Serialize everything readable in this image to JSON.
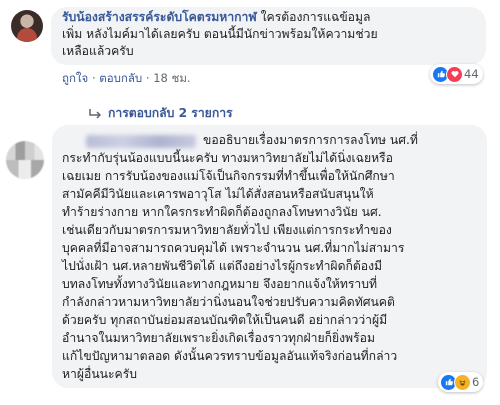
{
  "comment1": {
    "author": "รับน้องสร้างสรรค์ระดับโคตรมหากาฬ",
    "text_line1_rest": " ใครต้องการแฉข้อมูล",
    "text_line2": "เพิ่ม หลังไมค์มาได้เลยครับ ตอนนี้มีนักข่าวพร้อมให้ความช่วย",
    "text_line3": "เหลือแล้วครับ",
    "actions": {
      "like": "ถูกใจ",
      "reply": "ตอบกลับ",
      "dot": "·",
      "time": "18 ชม."
    },
    "reaction_count": "44",
    "replies_label": "การตอบกลับ 2 รายการ"
  },
  "comment2": {
    "lines": [
      "ขออธิบายเรื่องมาตรการการลงโทษ นศ.ที่",
      "กระทำกับรุ่นน้องแบบนี้นะครับ ทางมหาวิทยาลัยไม่ได้นิ่งเฉยหรือ",
      "เฉยเมย การรับน้องของแม่โจ้เป็นกิจกรรมที่ทำขึ้นเพื่อให้นักศึกษา",
      "สามัคคีมีวินัยและเคารพอาวุโส ไม่ได้สั่งสอนหรือสนับสนุนให้",
      "ทำร้ายร่างกาย หากใครกระทำผิดก็ต้องถูกลงโทษทางวินัย นศ.",
      "เช่นเดียวกับมาตรการมหาวิทยาลัยทั่วไป เพียงแต่การกระทำของ",
      "บุคคลที่มีอาจสามารถควบคุมได้ เพราะจำนวน นศ.ที่มากไม่สามาร",
      "ไปนั่งเฝ้า นศ.หลายพันชีวิตได้ แต่ถึงอย่างไรผู้กระทำผิดก็ต้องมี",
      "บทลงโทษทั้งทางวินัยและทางกฎหมาย จึงอยากแจ้งให้ทราบที่",
      "กำลังกล่าวหามหาวิทยาลัยว่านิ่งนอนใจช่วยปรับความคิดทัศนคติ",
      "ด้วยครับ ทุกสถาบันย่อมสอนบัณฑิตให้เป็นคนดี อย่ากล่าวว่าผู้มี",
      "อำนาจในมหาวิทยาลัยเพราะยิ่งเกิดเรื่องราวทุกฝ่ายก็ยิ่งพร้อม",
      "แก้ไขปัญหามาตลอด ดังนั้นควรทราบข้อมูลอันแท้จริงก่อนที่กล่าว",
      "หาผู้อื่นนะครับ"
    ],
    "reaction_count": "6"
  },
  "icons": {
    "like": "like-icon",
    "heart": "heart-icon",
    "haha": "haha-icon",
    "reply_arrow": "reply-arrow-icon"
  },
  "colors": {
    "link": "#385898",
    "bubble": "#f2f3f5",
    "meta": "#606770",
    "like": "#1877f2",
    "heart": "#f33e58"
  }
}
